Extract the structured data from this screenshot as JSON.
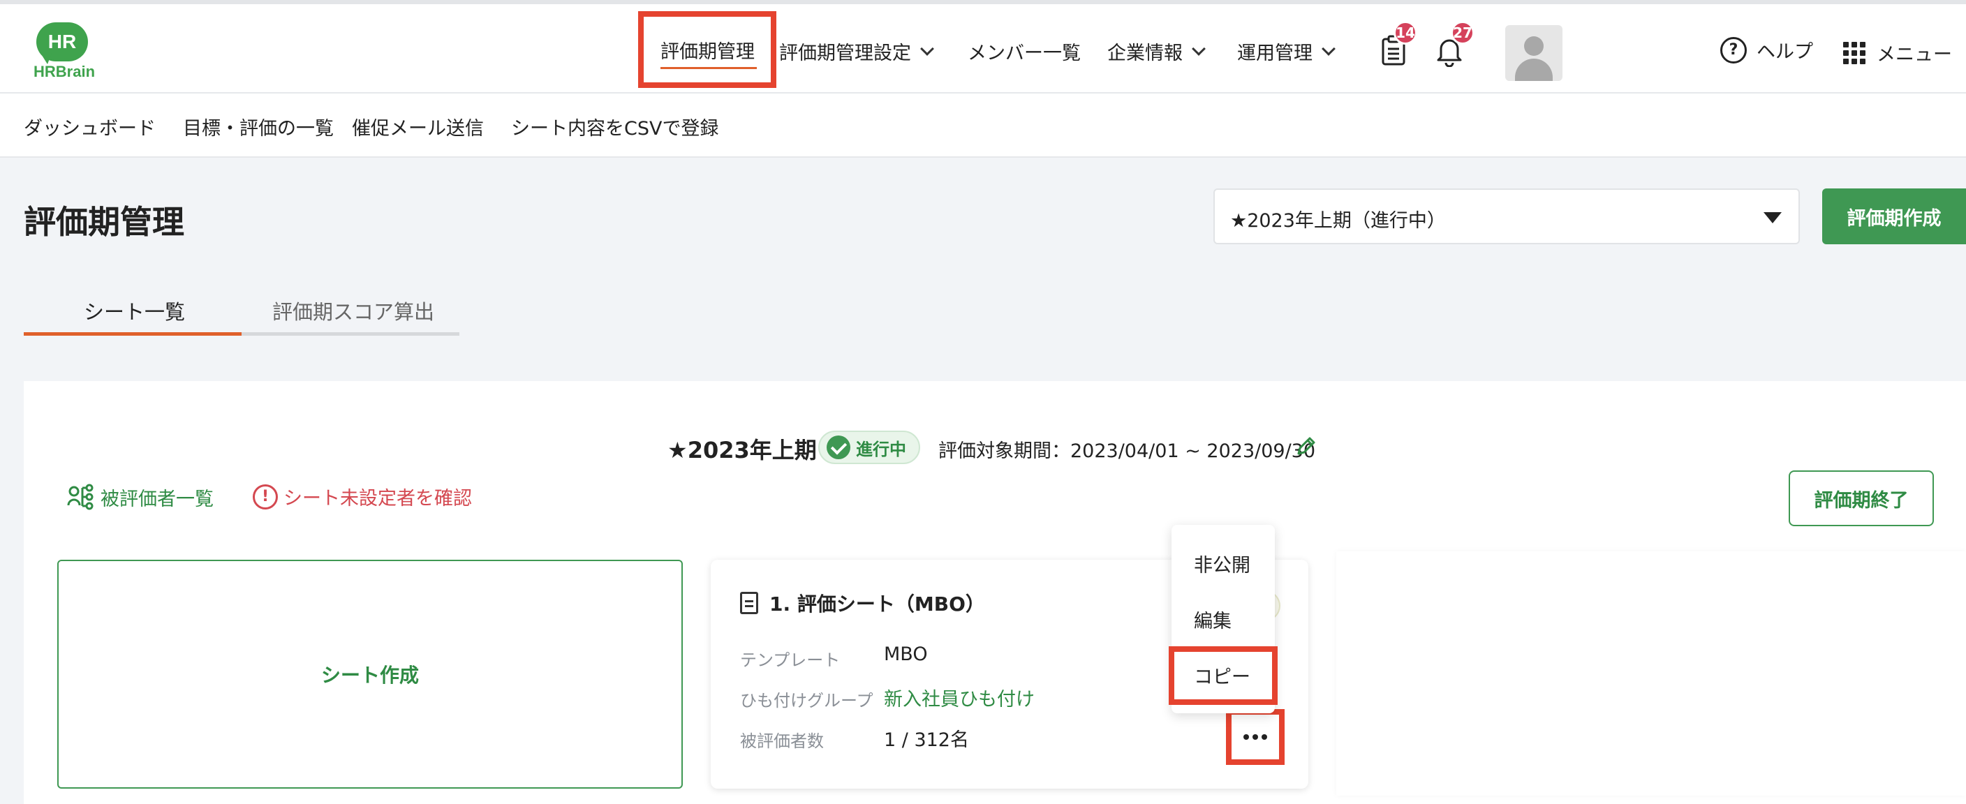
{
  "logo": {
    "bubble_text": "HR",
    "word_text": "HRBrain"
  },
  "topnav": {
    "active": "評価期管理",
    "items": [
      "評価期管理設定",
      "メンバー一覧",
      "企業情報",
      "運用管理"
    ],
    "tasks_badge": "14",
    "notifications_badge": "27",
    "help": "ヘルプ",
    "help_icon_glyph": "?",
    "menu": "メニュー"
  },
  "subnav": {
    "items": [
      "ダッシュボード",
      "目標・評価の一覧",
      "催促メール送信",
      "シート内容をCSVで登録"
    ]
  },
  "page": {
    "title": "評価期管理",
    "period_select_value": "★2023年上期（進行中）",
    "create_period_button": "評価期作成"
  },
  "tabs": [
    "シート一覧",
    "評価期スコア算出"
  ],
  "period": {
    "name": "★2023年上期",
    "status": "進行中",
    "range": "評価対象期間：2023/04/01 ~ 2023/09/30",
    "link_evaluatees": "被評価者一覧",
    "link_unset": "シート未設定者を確認",
    "warn_glyph": "!",
    "end_button": "評価期終了"
  },
  "create_sheet": {
    "label": "シート作成"
  },
  "sheet_card": {
    "title": "1. 評価シート（MBO）",
    "rows": [
      {
        "label": "テンプレート",
        "value": "MBO"
      },
      {
        "label": "ひも付けグループ",
        "value": "新入社員ひも付け"
      },
      {
        "label": "被評価者数",
        "value": "1 / 312名"
      }
    ]
  },
  "dropdown": {
    "items": [
      "非公開",
      "編集",
      "コピー"
    ]
  },
  "colors": {
    "brand_green": "#3f9853",
    "accent_orange": "#e0602b",
    "highlight_red": "#e5432f",
    "badge_red": "#d5425b"
  }
}
